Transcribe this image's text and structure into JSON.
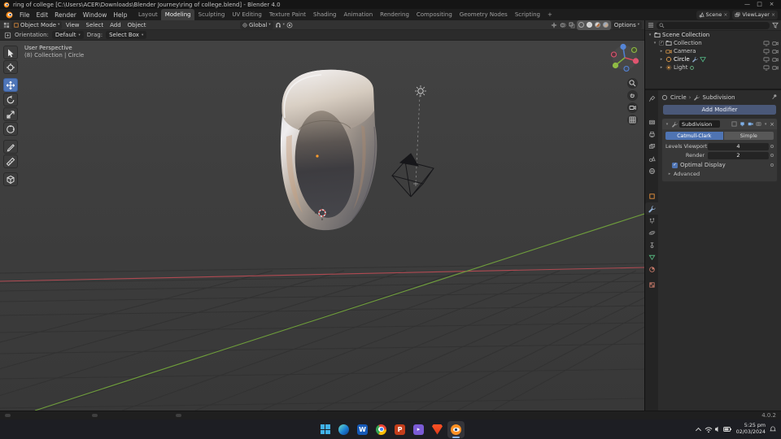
{
  "titlebar": {
    "title": "ring of college [C:\\Users\\ACER\\Downloads\\Blender Journey\\ring of college.blend] - Blender 4.0"
  },
  "topbar": {
    "menus": [
      "File",
      "Edit",
      "Render",
      "Window",
      "Help"
    ],
    "workspaces": [
      "Layout",
      "Modeling",
      "Sculpting",
      "UV Editing",
      "Texture Paint",
      "Shading",
      "Animation",
      "Rendering",
      "Compositing",
      "Geometry Nodes",
      "Scripting"
    ],
    "active_workspace": "Modeling",
    "add_workspace": "+",
    "scene": "Scene",
    "viewlayer": "ViewLayer"
  },
  "viewport_header": {
    "mode": "Object Mode",
    "menus": [
      "View",
      "Select",
      "Add",
      "Object"
    ],
    "orientation": "Global",
    "options": "Options"
  },
  "tool_settings": {
    "orientation_label": "Orientation:",
    "orientation_value": "Default",
    "drag_label": "Drag:",
    "drag_value": "Select Box"
  },
  "viewport": {
    "view_label": "User Perspective",
    "context_label": "(8) Collection | Circle"
  },
  "toolbar_tools": [
    "Select Box",
    "Cursor",
    "Move",
    "Rotate",
    "Scale",
    "Transform",
    "Annotate",
    "Measure",
    "Add Cube"
  ],
  "active_tool": "Move",
  "outliner": {
    "root_label": "Scene Collection",
    "items": [
      {
        "label": "Collection",
        "icon": "collection-icon"
      },
      {
        "label": "Camera",
        "icon": "camera-icon"
      },
      {
        "label": "Circle",
        "icon": "mesh-circle-icon"
      },
      {
        "label": "Light",
        "icon": "light-icon"
      }
    ]
  },
  "properties": {
    "tabs": [
      "Tool",
      "Render",
      "Output",
      "View Layer",
      "Scene",
      "World",
      "Object",
      "Modifiers",
      "Particles",
      "Physics",
      "Constraints",
      "Object Data",
      "Material",
      "Texture"
    ],
    "active_tab": "Modifiers",
    "breadcrumb": {
      "object": "Circle",
      "modifier": "Subdivision"
    },
    "add_modifier_label": "Add Modifier",
    "modifier": {
      "name": "Subdivision",
      "types": [
        "Catmull-Clark",
        "Simple"
      ],
      "active_type": "Catmull-Clark",
      "rows": [
        {
          "label": "Levels Viewport",
          "value": "4"
        },
        {
          "label": "Render",
          "value": "2"
        }
      ],
      "optimal_display_label": "Optimal Display",
      "optimal_display_checked": true,
      "advanced_label": "Advanced"
    }
  },
  "statusbar": {
    "version": "4.0.2"
  },
  "taskbar": {
    "time": "5:25 pm",
    "date": "02/03/2024",
    "apps": [
      "windows-start",
      "edge",
      "word",
      "chrome",
      "powerpoint",
      "purple-app",
      "brave",
      "blender"
    ],
    "active_app": "blender"
  },
  "colors": {
    "accent_blue": "#4f74b3",
    "axis_x_red": "#b04a52",
    "axis_y_green": "#6f9e3c",
    "object_orange": "#e8923c"
  }
}
